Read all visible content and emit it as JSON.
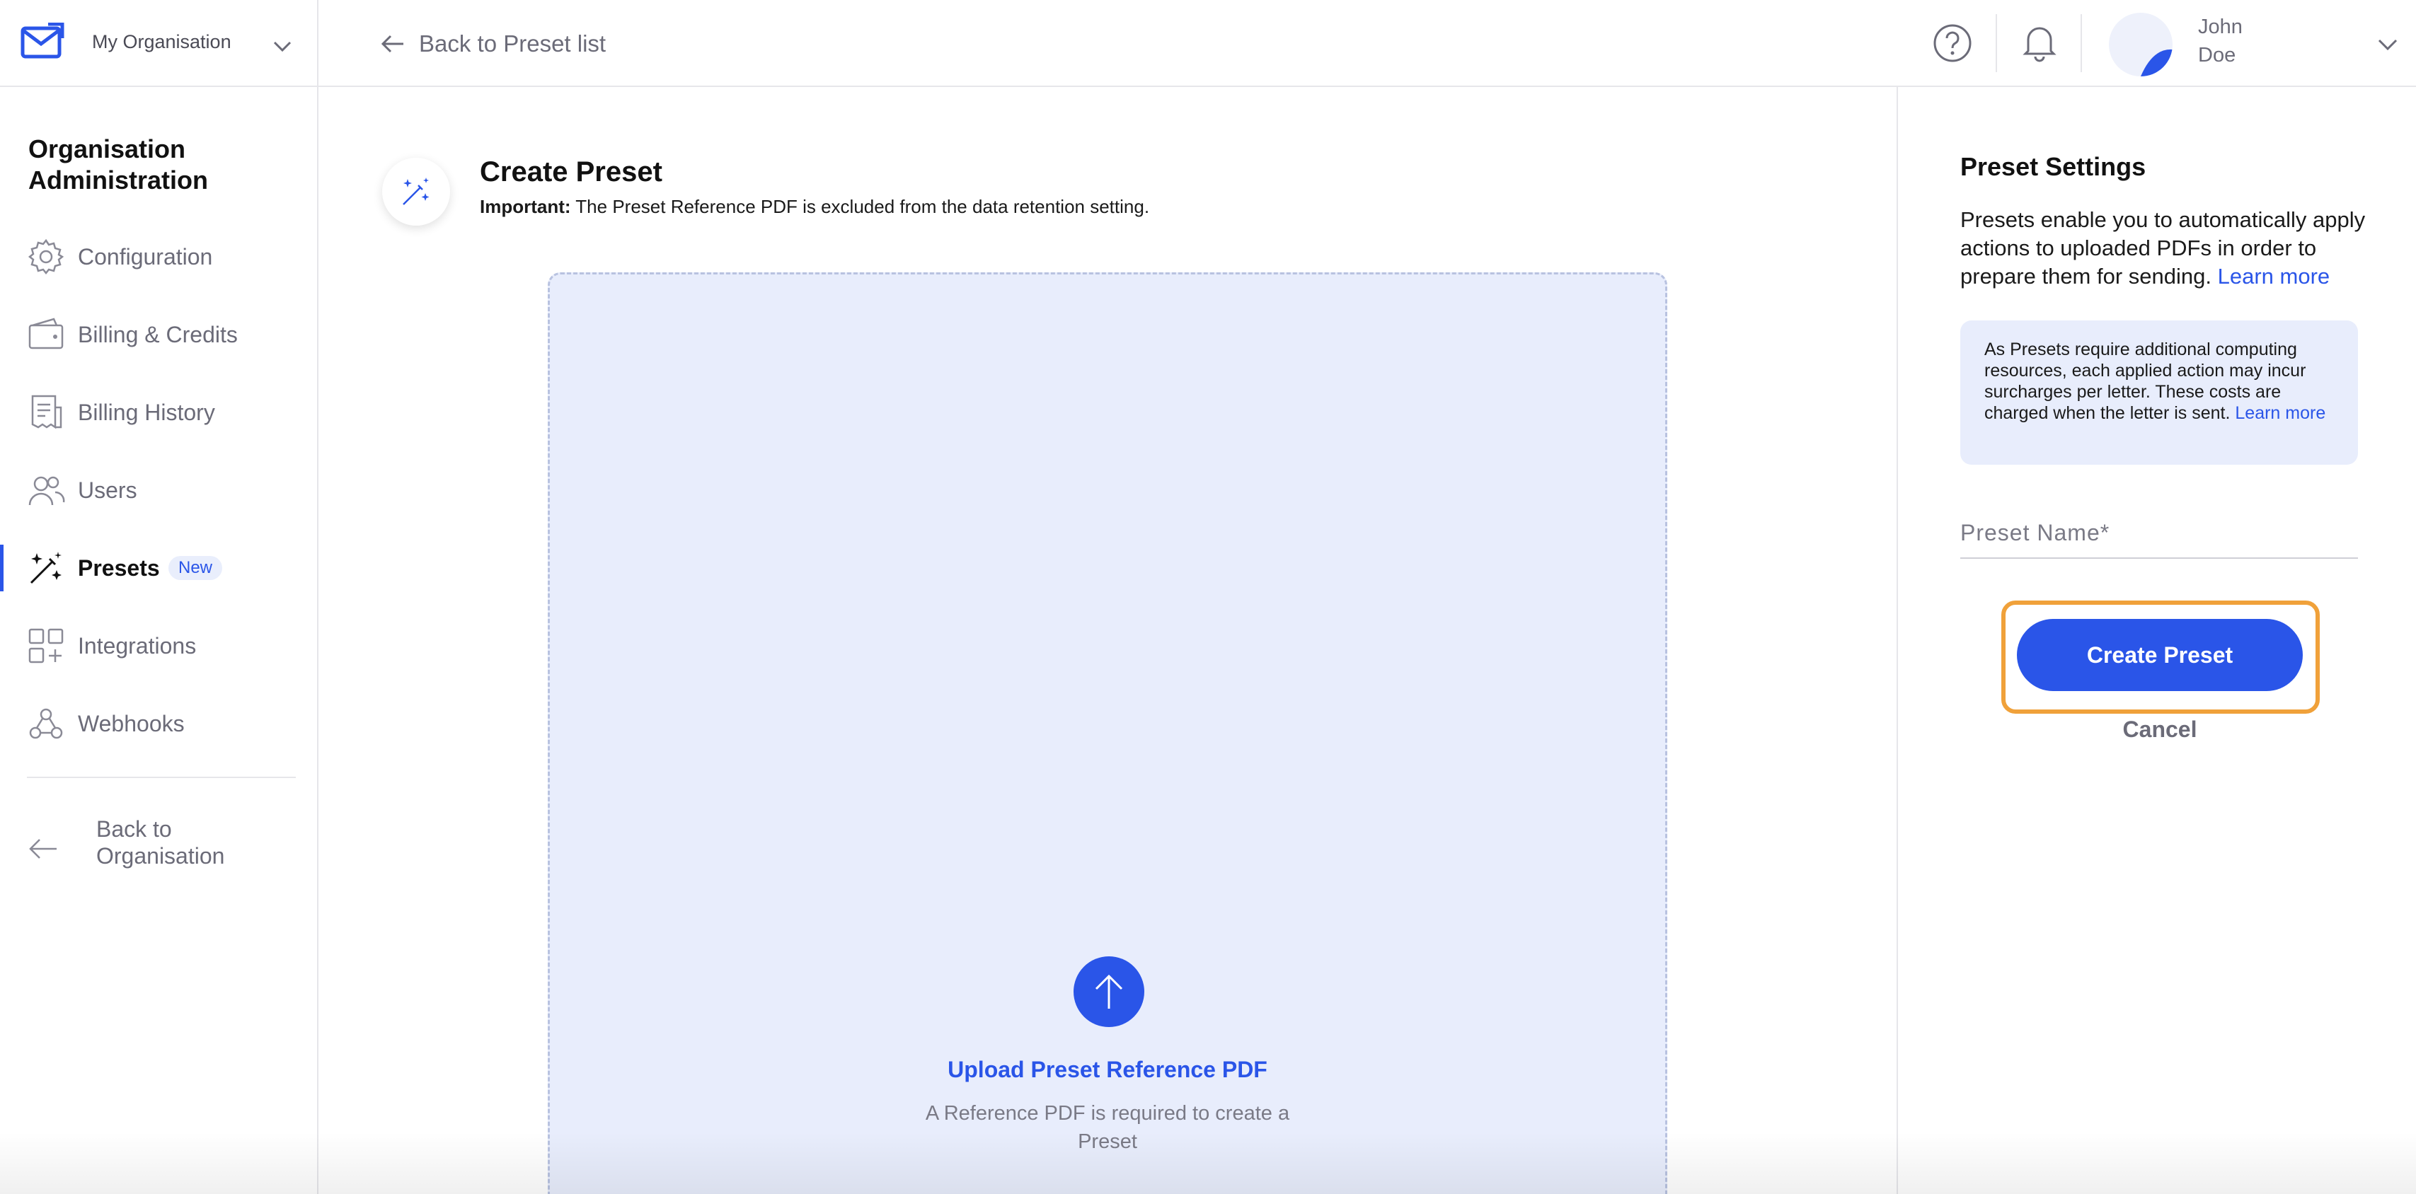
{
  "topbar": {
    "org_name": "My Organisation",
    "back_label": "Back to Preset list",
    "user_first": "John",
    "user_last": "Doe"
  },
  "sidebar": {
    "title": "Organisation Administration",
    "items": [
      {
        "label": "Configuration",
        "icon": "gear-icon"
      },
      {
        "label": "Billing & Credits",
        "icon": "wallet-icon"
      },
      {
        "label": "Billing History",
        "icon": "receipt-icon"
      },
      {
        "label": "Users",
        "icon": "users-icon"
      },
      {
        "label": "Presets",
        "icon": "magic-wand-icon",
        "active": true,
        "badge": "New"
      },
      {
        "label": "Integrations",
        "icon": "grid-plus-icon"
      },
      {
        "label": "Webhooks",
        "icon": "webhook-icon"
      }
    ],
    "back_label": "Back to Organisation"
  },
  "main": {
    "title": "Create Preset",
    "note_strong": "Important:",
    "note_text": " The Preset Reference PDF is excluded from the data retention setting.",
    "upload_link": "Upload Preset Reference PDF",
    "upload_hint": "A Reference PDF is required to create a Preset"
  },
  "settings": {
    "title": "Preset Settings",
    "desc": "Presets enable you to automatically apply actions to uploaded PDFs in order to prepare them for sending.",
    "desc_link": "Learn more",
    "info": "As Presets require additional computing resources, each applied action may incur surcharges per letter. These costs are charged when the letter is sent.",
    "info_link": "Learn more",
    "name_label": "Preset Name*",
    "name_value": "",
    "create_label": "Create Preset",
    "cancel_label": "Cancel"
  },
  "colors": {
    "accent": "#2a55e8",
    "highlight": "#f0a13a",
    "dropzone": "#e8edfc"
  }
}
